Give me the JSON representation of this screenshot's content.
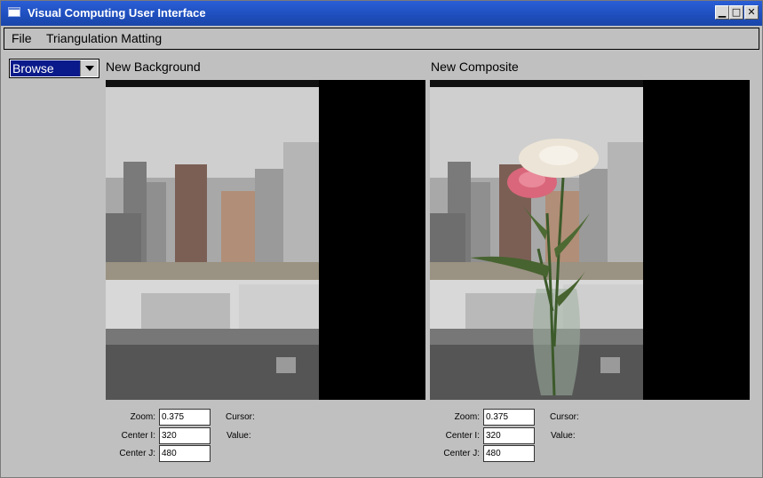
{
  "window": {
    "title": "Visual Computing User Interface"
  },
  "menu": {
    "items": [
      "File",
      "Triangulation Matting"
    ]
  },
  "mode": {
    "selected": "Browse"
  },
  "panels": [
    {
      "label": "New Background",
      "zoom_label": "Zoom:",
      "zoom": "0.375",
      "center_i_label": "Center I:",
      "center_i": "320",
      "center_j_label": "Center J:",
      "center_j": "480",
      "cursor_label": "Cursor:",
      "value_label": "Value:"
    },
    {
      "label": "New Composite",
      "zoom_label": "Zoom:",
      "zoom": "0.375",
      "center_i_label": "Center I:",
      "center_i": "320",
      "center_j_label": "Center J:",
      "center_j": "480",
      "cursor_label": "Cursor:",
      "value_label": "Value:"
    }
  ],
  "icons": {
    "app": "window-icon",
    "minimize": "minimize-icon",
    "maximize": "maximize-icon",
    "close": "close-icon",
    "dropdown": "chevron-down-icon"
  },
  "colors": {
    "titlebar": "#1f4fbf",
    "selection": "#0a1a8a",
    "background": "#c0c0c0"
  }
}
